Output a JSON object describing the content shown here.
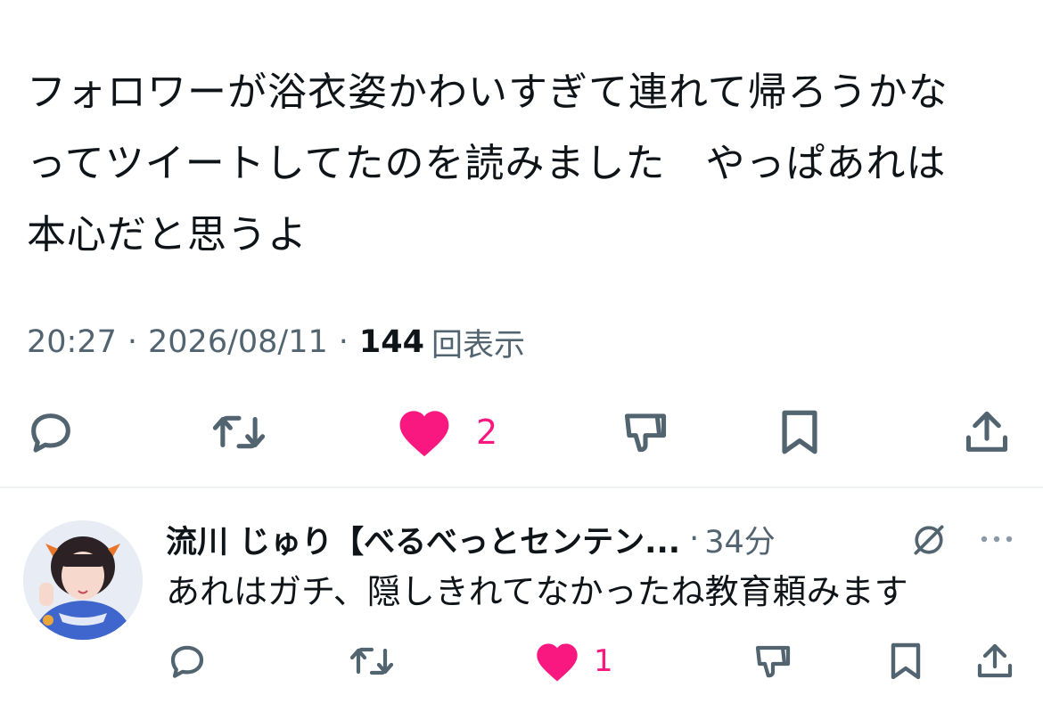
{
  "tweet": {
    "text_lines": [
      "フォロワーが浴衣姿かわいすぎて連れて帰ろうかな",
      "ってツイートしてたのを読みました　やっぱあれは",
      "本心だと思うよ"
    ],
    "time": "20:27",
    "date": "2026/08/11",
    "separator": "·",
    "view_count": "144",
    "view_label": "回表示",
    "actions": {
      "reply_icon": "reply-icon",
      "retweet_icon": "retweet-icon",
      "like_icon": "heart-filled-icon",
      "like_count": "2",
      "dislike_icon": "thumbs-down-icon",
      "bookmark_icon": "bookmark-icon",
      "share_icon": "share-icon"
    }
  },
  "reply": {
    "author_name": "流川 じゅり【べるべっとセンテン...",
    "separator": "·",
    "time_ago": "34分",
    "grok_icon": "grok-icon",
    "more_icon": "more-dots-icon",
    "text": "あれはガチ、隠しきれてなかったね教育頼みます",
    "like_count": "1"
  },
  "colors": {
    "text_primary": "#0f1419",
    "text_secondary": "#536471",
    "like_pink": "#f91880",
    "icon_gray": "#536471",
    "divider": "#eff3f4"
  }
}
